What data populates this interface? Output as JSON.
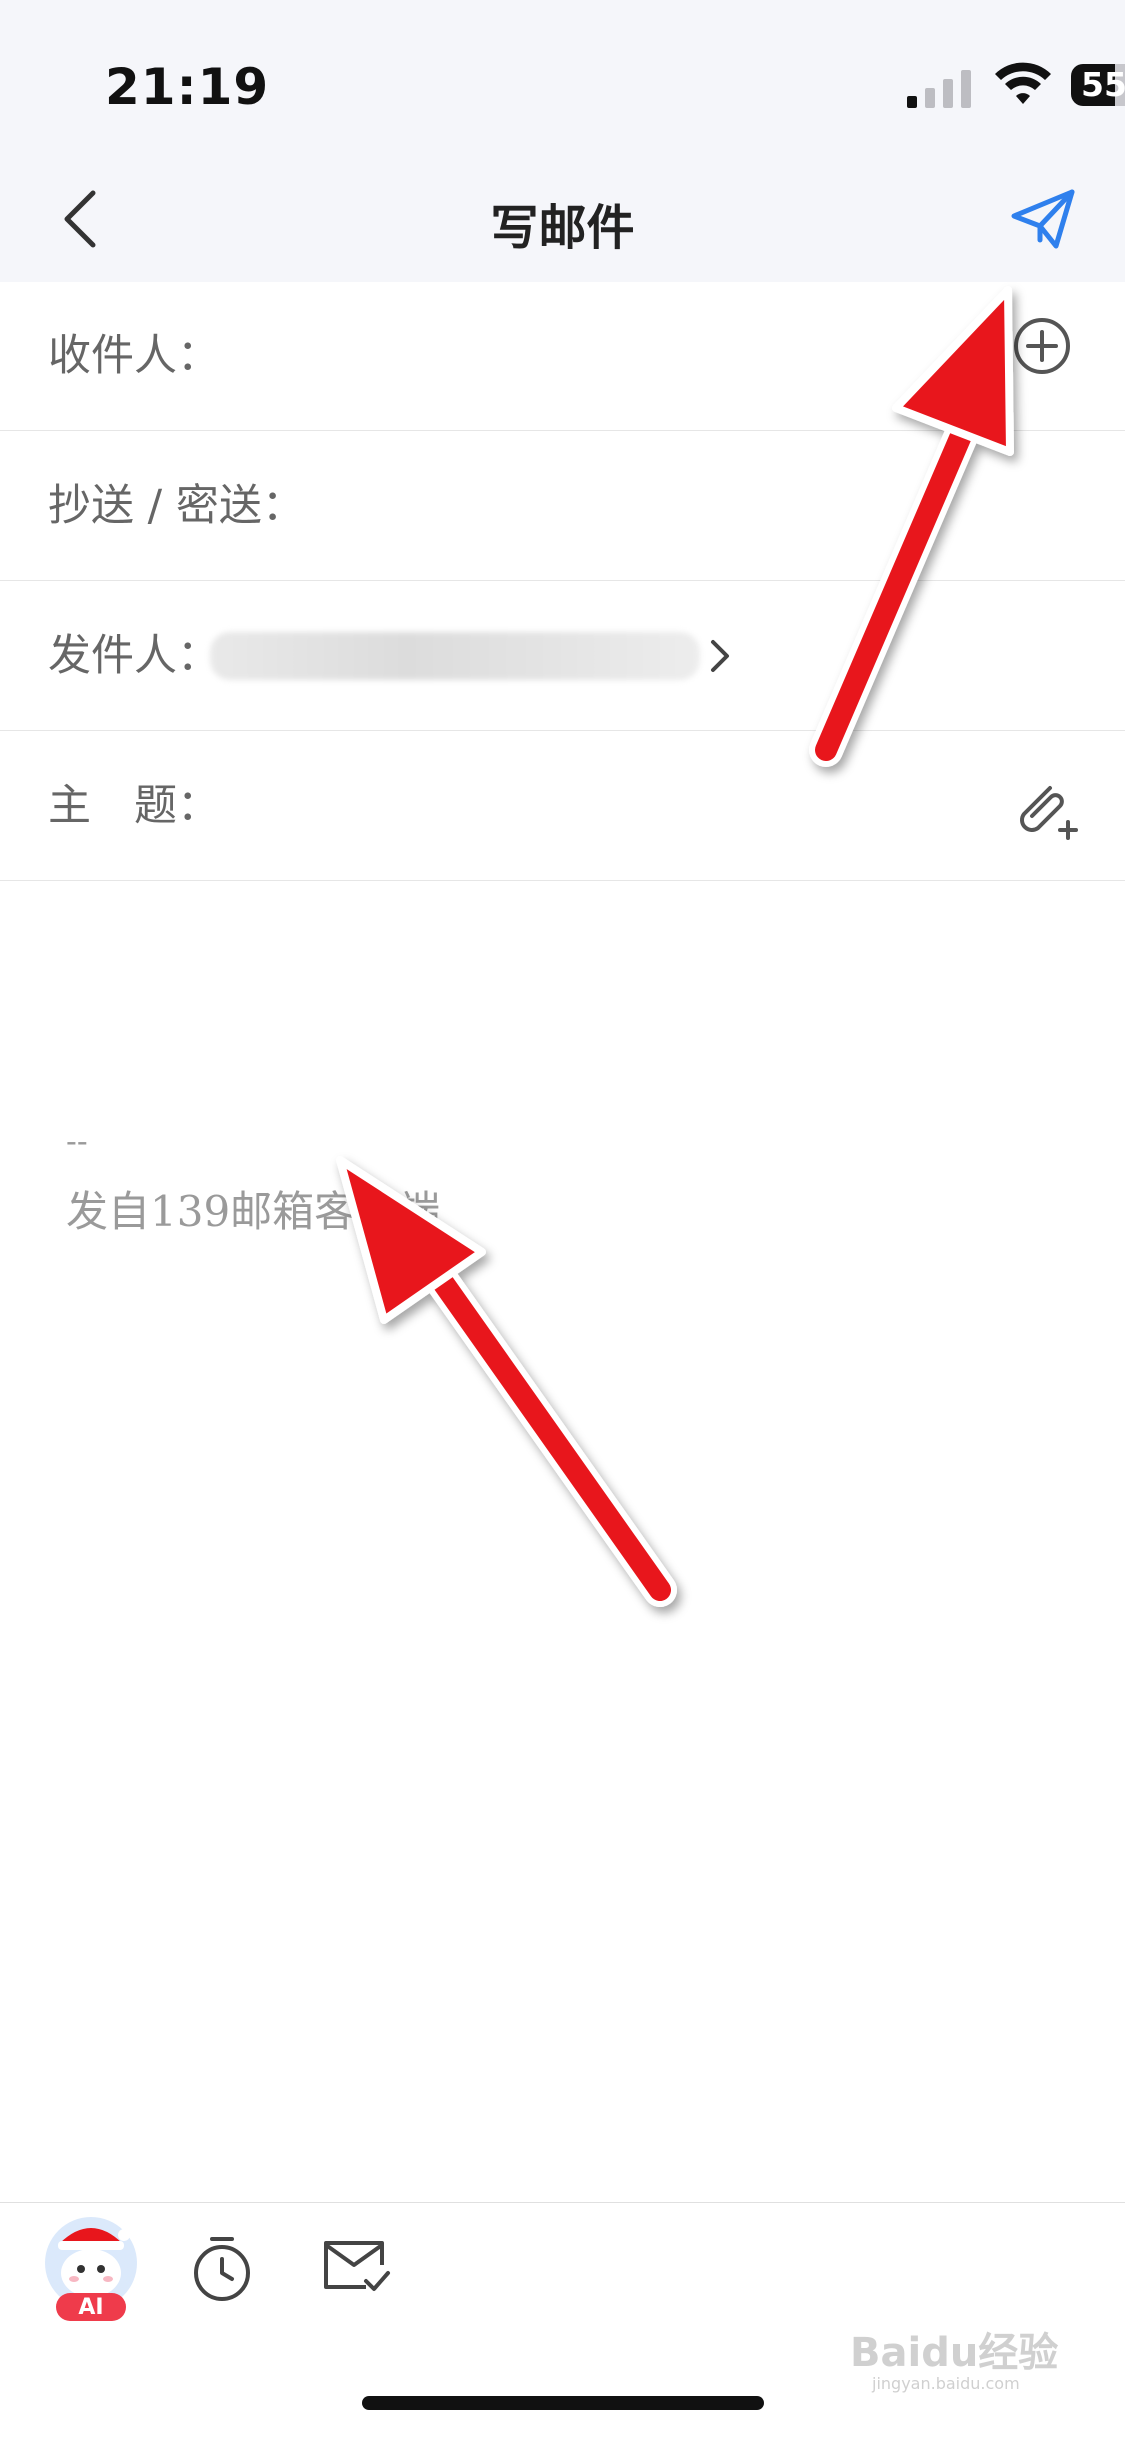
{
  "status_bar": {
    "time": "21:19",
    "battery": "55",
    "icons": [
      "cellular-signal-icon",
      "wifi-icon",
      "battery-icon"
    ]
  },
  "header": {
    "title": "写邮件",
    "back_icon": "chevron-left-icon",
    "send_icon": "paper-plane-icon"
  },
  "fields": {
    "to_label": "收件人：",
    "cc_bcc_label": "抄送 / 密送：",
    "from_label": "发件人：",
    "subject_label": "主　题："
  },
  "body": {
    "signature_dash": "--",
    "signature": "发自139邮箱客户端"
  },
  "toolbar": {
    "ai_label": "AI",
    "icons": [
      "ai-assistant-icon",
      "timer-icon",
      "mail-check-icon"
    ]
  },
  "watermark": {
    "text": "Baidu经验",
    "sub": "jingyan.baidu.com"
  },
  "colors": {
    "accent": "#2f80ed",
    "arrow": "#e8161c",
    "header_bg": "#f5f6fa"
  }
}
